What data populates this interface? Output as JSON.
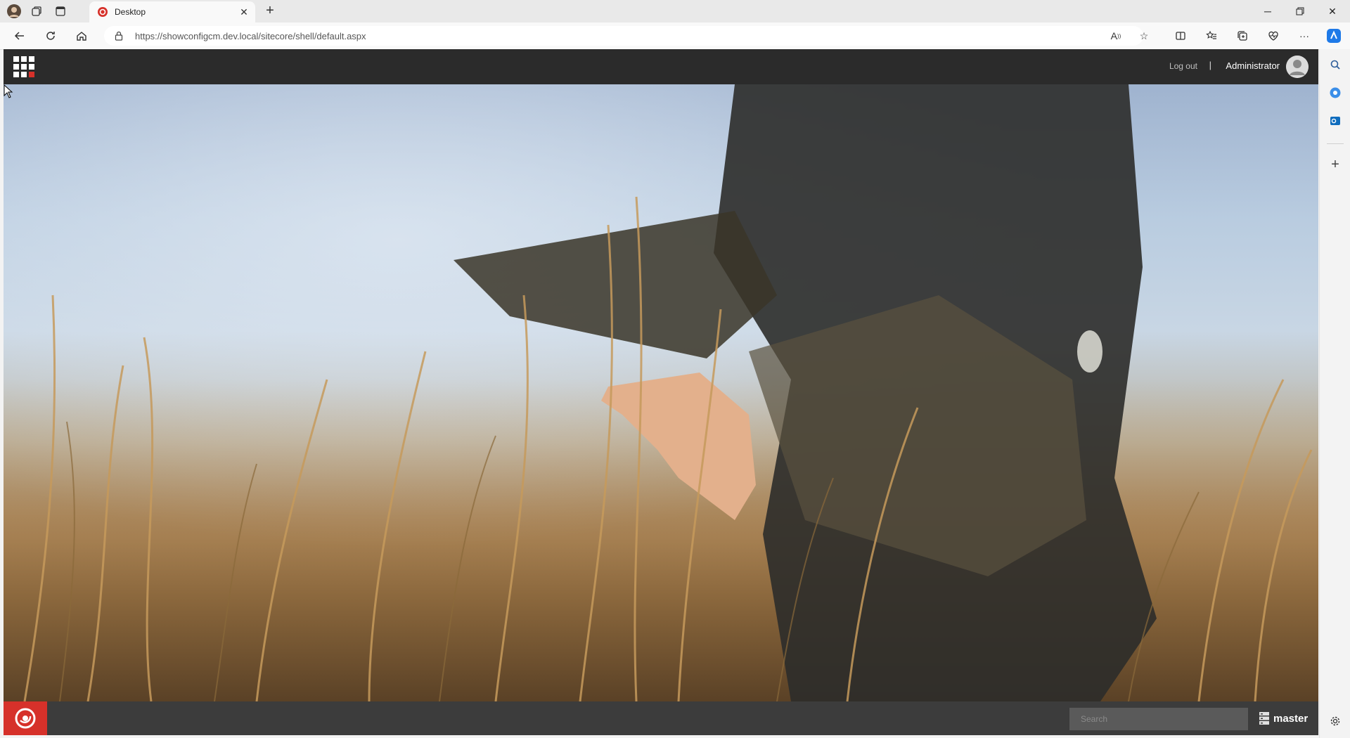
{
  "browser": {
    "tab": {
      "title": "Desktop"
    },
    "address": {
      "url": "https://showconfigcm.dev.local/sitecore/shell/default.aspx"
    },
    "icons": {
      "profile": "profile-avatar",
      "workspaces": "workspaces-icon",
      "tab_actions": "tab-actions-icon",
      "new_tab": "plus-icon",
      "back": "back-arrow-icon",
      "refresh": "refresh-icon",
      "home": "home-icon",
      "lock": "lock-icon",
      "read_aloud": "read-aloud-icon",
      "favorite": "star-icon",
      "split_screen": "split-screen-icon",
      "favorites": "favorites-icon",
      "collections": "collections-icon",
      "browser_essentials": "heart-pulse-icon",
      "more": "more-icon",
      "copilot": "copilot-icon"
    },
    "sidebar": [
      "search-icon",
      "office-icon",
      "outlook-icon",
      "plus-icon",
      "settings-icon"
    ]
  },
  "sitecore": {
    "header": {
      "logout_label": "Log out",
      "separator": "|",
      "username": "Administrator"
    },
    "taskbar": {
      "search_placeholder": "Search",
      "database": "master"
    },
    "colors": {
      "header_bg": "#2b2b2b",
      "taskbar_bg": "#3c3c3c",
      "brand_red": "#d6312a"
    }
  }
}
